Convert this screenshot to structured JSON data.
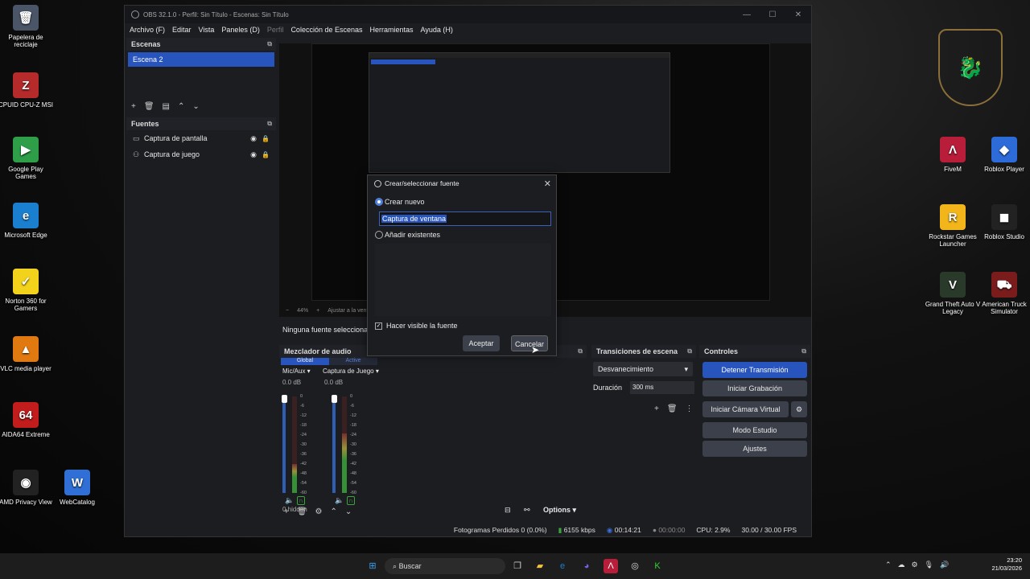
{
  "desktop": {
    "left_icons": [
      {
        "label": "Papelera de reciclaje",
        "icon": "recycle-bin-icon",
        "color": "#4a5568",
        "glyph": "🗑"
      },
      {
        "label": "CPUID CPU-Z MSI",
        "icon": "cpuz-icon",
        "color": "#b52a2a",
        "glyph": "Z"
      },
      {
        "label": "Google Play Games",
        "icon": "google-play-icon",
        "color": "#2e9e48",
        "glyph": "▶"
      },
      {
        "label": "Microsoft Edge",
        "icon": "edge-icon",
        "color": "#1b7fcf",
        "glyph": "e"
      },
      {
        "label": "Norton 360 for Gamers",
        "icon": "norton-icon",
        "color": "#f2d21a",
        "glyph": "✓"
      },
      {
        "label": "VLC media player",
        "icon": "vlc-icon",
        "color": "#e07a10",
        "glyph": "▲"
      },
      {
        "label": "AIDA64 Extreme",
        "icon": "aida64-icon",
        "color": "#c21c1c",
        "glyph": "64"
      },
      {
        "label": "AMD Privacy View",
        "icon": "amd-privacy-icon",
        "color": "#222222",
        "glyph": "◉"
      },
      {
        "label": "WebCatalog",
        "icon": "webcatalog-icon",
        "color": "#2f6fd6",
        "glyph": "W"
      }
    ],
    "right_icons": [
      {
        "label": "FiveM",
        "icon": "fivem-icon",
        "color": "#b81d3a",
        "glyph": "Λ"
      },
      {
        "label": "Roblox Player",
        "icon": "roblox-player-icon",
        "color": "#2d6bd8",
        "glyph": "◆"
      },
      {
        "label": "Rockstar Games Launcher",
        "icon": "rockstar-icon",
        "color": "#f3b61a",
        "glyph": "R"
      },
      {
        "label": "Roblox Studio",
        "icon": "roblox-studio-icon",
        "color": "#222222",
        "glyph": "◼"
      },
      {
        "label": "Grand Theft Auto V Legacy",
        "icon": "gta-icon",
        "color": "#2a3a2a",
        "glyph": "V"
      },
      {
        "label": "American Truck Simulator",
        "icon": "ats-icon",
        "color": "#7a1c1c",
        "glyph": "⛟"
      }
    ]
  },
  "obs": {
    "title": "OBS 32.1.0 - Perfil: Sin Título - Escenas: Sin Título",
    "menu": [
      "Archivo (F)",
      "Editar",
      "Vista",
      "Paneles (D)",
      "Perfil",
      "Colección de Escenas",
      "Herramientas",
      "Ayuda (H)"
    ],
    "scenes": {
      "header": "Escenas",
      "items": [
        "Escena 2"
      ]
    },
    "sources": {
      "header": "Fuentes",
      "items": [
        {
          "name": "Captura de pantalla",
          "icon": "monitor-icon"
        },
        {
          "name": "Captura de juego",
          "icon": "gamepad-icon"
        }
      ]
    },
    "preview": {
      "zoom": "44%",
      "adjust": "Ajustar a la venta",
      "no_source": "Ninguna fuente seleccionada"
    },
    "dialog": {
      "title": "Crear/seleccionar fuente",
      "create_new": "Crear nuevo",
      "name_value": "Captura de ventana",
      "add_existing": "Añadir existentes",
      "visible_label": "Hacer visible la fuente",
      "ok": "Aceptar",
      "cancel": "Cancelar"
    },
    "mixer": {
      "header": "Mezclador de audio",
      "tab_global": "Global",
      "tab_active": "Active",
      "channels": [
        {
          "name": "Mic/Aux",
          "db": "0.0 dB",
          "level": 0.3
        },
        {
          "name": "Captura de Juego",
          "db": "0.0 dB",
          "level": 0.62
        }
      ],
      "scale": [
        "0",
        "-6",
        "-12",
        "-18",
        "-24",
        "-30",
        "-36",
        "-42",
        "-48",
        "-54",
        "-60"
      ],
      "hidden": "0 hidden",
      "options": "Options"
    },
    "transitions": {
      "header": "Transiciones de escena",
      "selected": "Desvanecimiento",
      "duration_label": "Duración",
      "duration_value": "300 ms"
    },
    "controls": {
      "header": "Controles",
      "buttons": [
        "Detener Transmisión",
        "Iniciar Grabación",
        "Iniciar Cámara Virtual",
        "Modo Estudio",
        "Ajustes"
      ]
    },
    "status": {
      "frames_dropped": "Fotogramas Perdidos 0 (0.0%)",
      "bitrate": "6155 kbps",
      "stream_time": "00:14:21",
      "rec_time": "00:00:00",
      "cpu": "CPU: 2.9%",
      "fps": "30.00 / 30.00 FPS"
    }
  },
  "taskbar": {
    "search": "Buscar",
    "time": "23:20",
    "date": "21/03/2026"
  }
}
